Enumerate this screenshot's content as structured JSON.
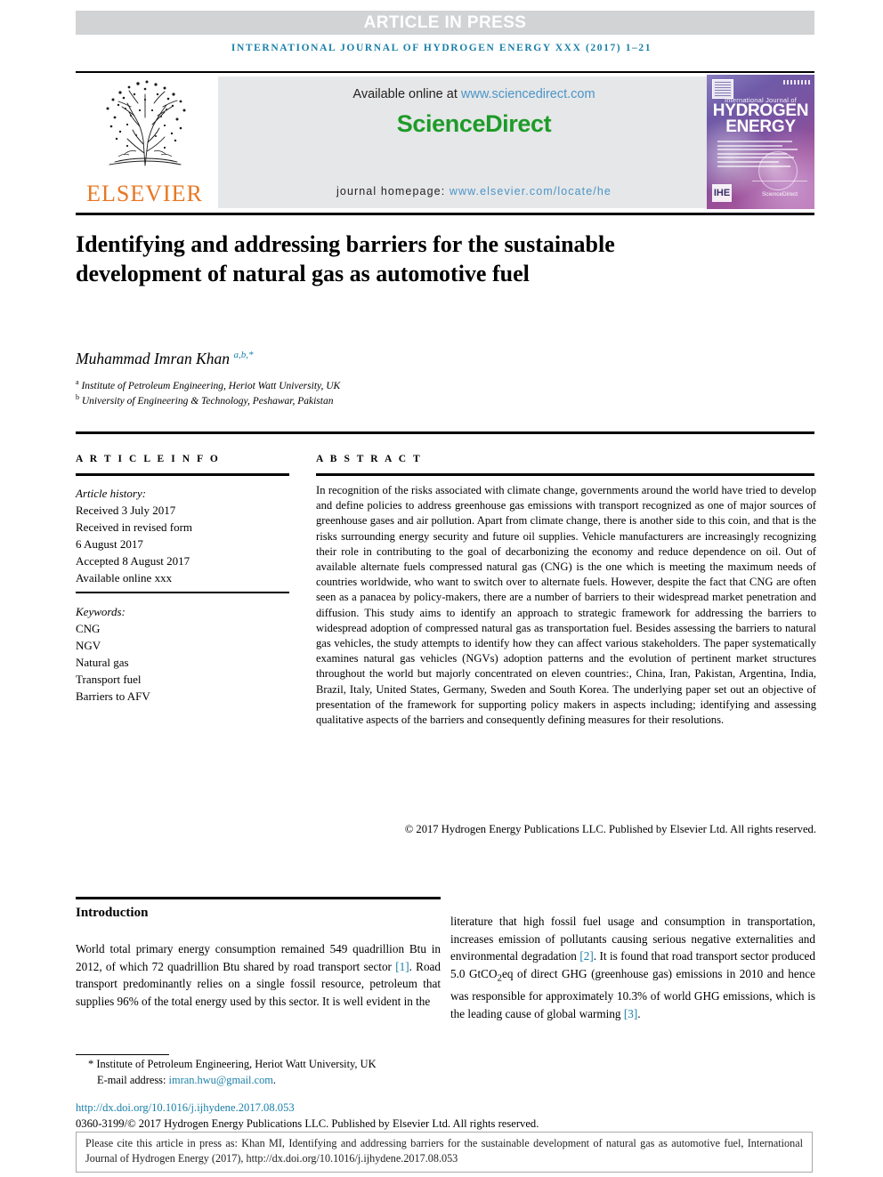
{
  "banner": {
    "article_in_press": "ARTICLE IN PRESS",
    "running_head": "INTERNATIONAL JOURNAL OF HYDROGEN ENERGY XXX (2017) 1–21"
  },
  "masthead": {
    "publisher": "ELSEVIER",
    "available_prefix": "Available online at ",
    "available_url": "www.sciencedirect.com",
    "sciencedirect_logo": "ScienceDirect",
    "homepage_prefix": "journal homepage: ",
    "homepage_url": "www.elsevier.com/locate/he",
    "cover": {
      "superline": "International Journal of",
      "title_line1": "HYDROGEN",
      "title_line2": "ENERGY",
      "badge": "IHE",
      "footer": "ScienceDirect"
    }
  },
  "article": {
    "title": "Identifying and addressing barriers for the sustainable development of natural gas as automotive fuel",
    "author_name": "Muhammad Imran Khan",
    "author_marks": "a,b,*",
    "affiliation_a_mark": "a",
    "affiliation_a": "Institute of Petroleum Engineering, Heriot Watt University, UK",
    "affiliation_b_mark": "b",
    "affiliation_b": "University of Engineering & Technology, Peshawar, Pakistan"
  },
  "info": {
    "heading": "A R T I C L E   I N F O",
    "history_label": "Article history:",
    "received": "Received 3 July 2017",
    "revised_label": "Received in revised form",
    "revised_date": "6 August 2017",
    "accepted": "Accepted 8 August 2017",
    "available_online": "Available online xxx",
    "keywords_label": "Keywords:",
    "keywords": [
      "CNG",
      "NGV",
      "Natural gas",
      "Transport fuel",
      "Barriers to AFV"
    ]
  },
  "abstract": {
    "heading": "A B S T R A C T",
    "text": "In recognition of the risks associated with climate change, governments around the world have tried to develop and define policies to address greenhouse gas emissions with transport recognized as one of major sources of greenhouse gases and air pollution. Apart from climate change, there is another side to this coin, and that is the risks surrounding energy security and future oil supplies. Vehicle manufacturers are increasingly recognizing their role in contributing to the goal of decarbonizing the economy and reduce dependence on oil. Out of available alternate fuels compressed natural gas (CNG) is the one which is meeting the maximum needs of countries worldwide, who want to switch over to alternate fuels. However, despite the fact that CNG are often seen as a panacea by policy-makers, there are a number of barriers to their widespread market penetration and diffusion. This study aims to identify an approach to strategic framework for addressing the barriers to widespread adoption of compressed natural gas as transportation fuel. Besides assessing the barriers to natural gas vehicles, the study attempts to identify how they can affect various stakeholders. The paper systematically examines natural gas vehicles (NGVs) adoption patterns and the evolution of pertinent market structures throughout the world but majorly concentrated on eleven countries:, China, Iran, Pakistan, Argentina, India, Brazil, Italy, United States, Germany, Sweden and South Korea. The underlying paper set out an objective of presentation of the framework for supporting policy makers in aspects including; identifying and assessing qualitative aspects of the barriers and consequently defining measures for their resolutions.",
    "copyright": "© 2017 Hydrogen Energy Publications LLC. Published by Elsevier Ltd. All rights reserved."
  },
  "body": {
    "intro_heading": "Introduction",
    "left_p1_a": "World total primary energy consumption remained 549 quadrillion Btu in 2012, of which 72 quadrillion Btu shared by road transport sector ",
    "left_ref1": "[1]",
    "left_p1_b": ". Road transport predominantly relies on a single fossil resource, petroleum that supplies 96% of the total energy used by this sector. It is well evident in the",
    "right_p1_a": "literature that high fossil fuel usage and consumption in transportation, increases emission of pollutants causing serious negative externalities and environmental degradation ",
    "right_ref2": "[2]",
    "right_p1_b": ". It is found that road transport sector produced 5.0 GtCO",
    "right_sub": "2",
    "right_p1_c": "eq of direct GHG (greenhouse gas) emissions in 2010 and hence was responsible for approximately 10.3% of world GHG emissions, which is the leading cause of global warming ",
    "right_ref3": "[3]",
    "right_p1_d": "."
  },
  "footnotes": {
    "star_mark": "*",
    "corresponding_affil": "Institute of Petroleum Engineering, Heriot Watt University, UK",
    "email_label": "E-mail address: ",
    "email": "imran.hwu@gmail.com",
    "email_suffix": ".",
    "doi": "http://dx.doi.org/10.1016/j.ijhydene.2017.08.053",
    "issn_line": "0360-3199/© 2017 Hydrogen Energy Publications LLC. Published by Elsevier Ltd. All rights reserved."
  },
  "cite_box": {
    "text": "Please cite this article in press as: Khan MI, Identifying and addressing barriers for the sustainable development of natural gas as automotive fuel, International Journal of Hydrogen Energy (2017), http://dx.doi.org/10.1016/j.ijhydene.2017.08.053"
  }
}
